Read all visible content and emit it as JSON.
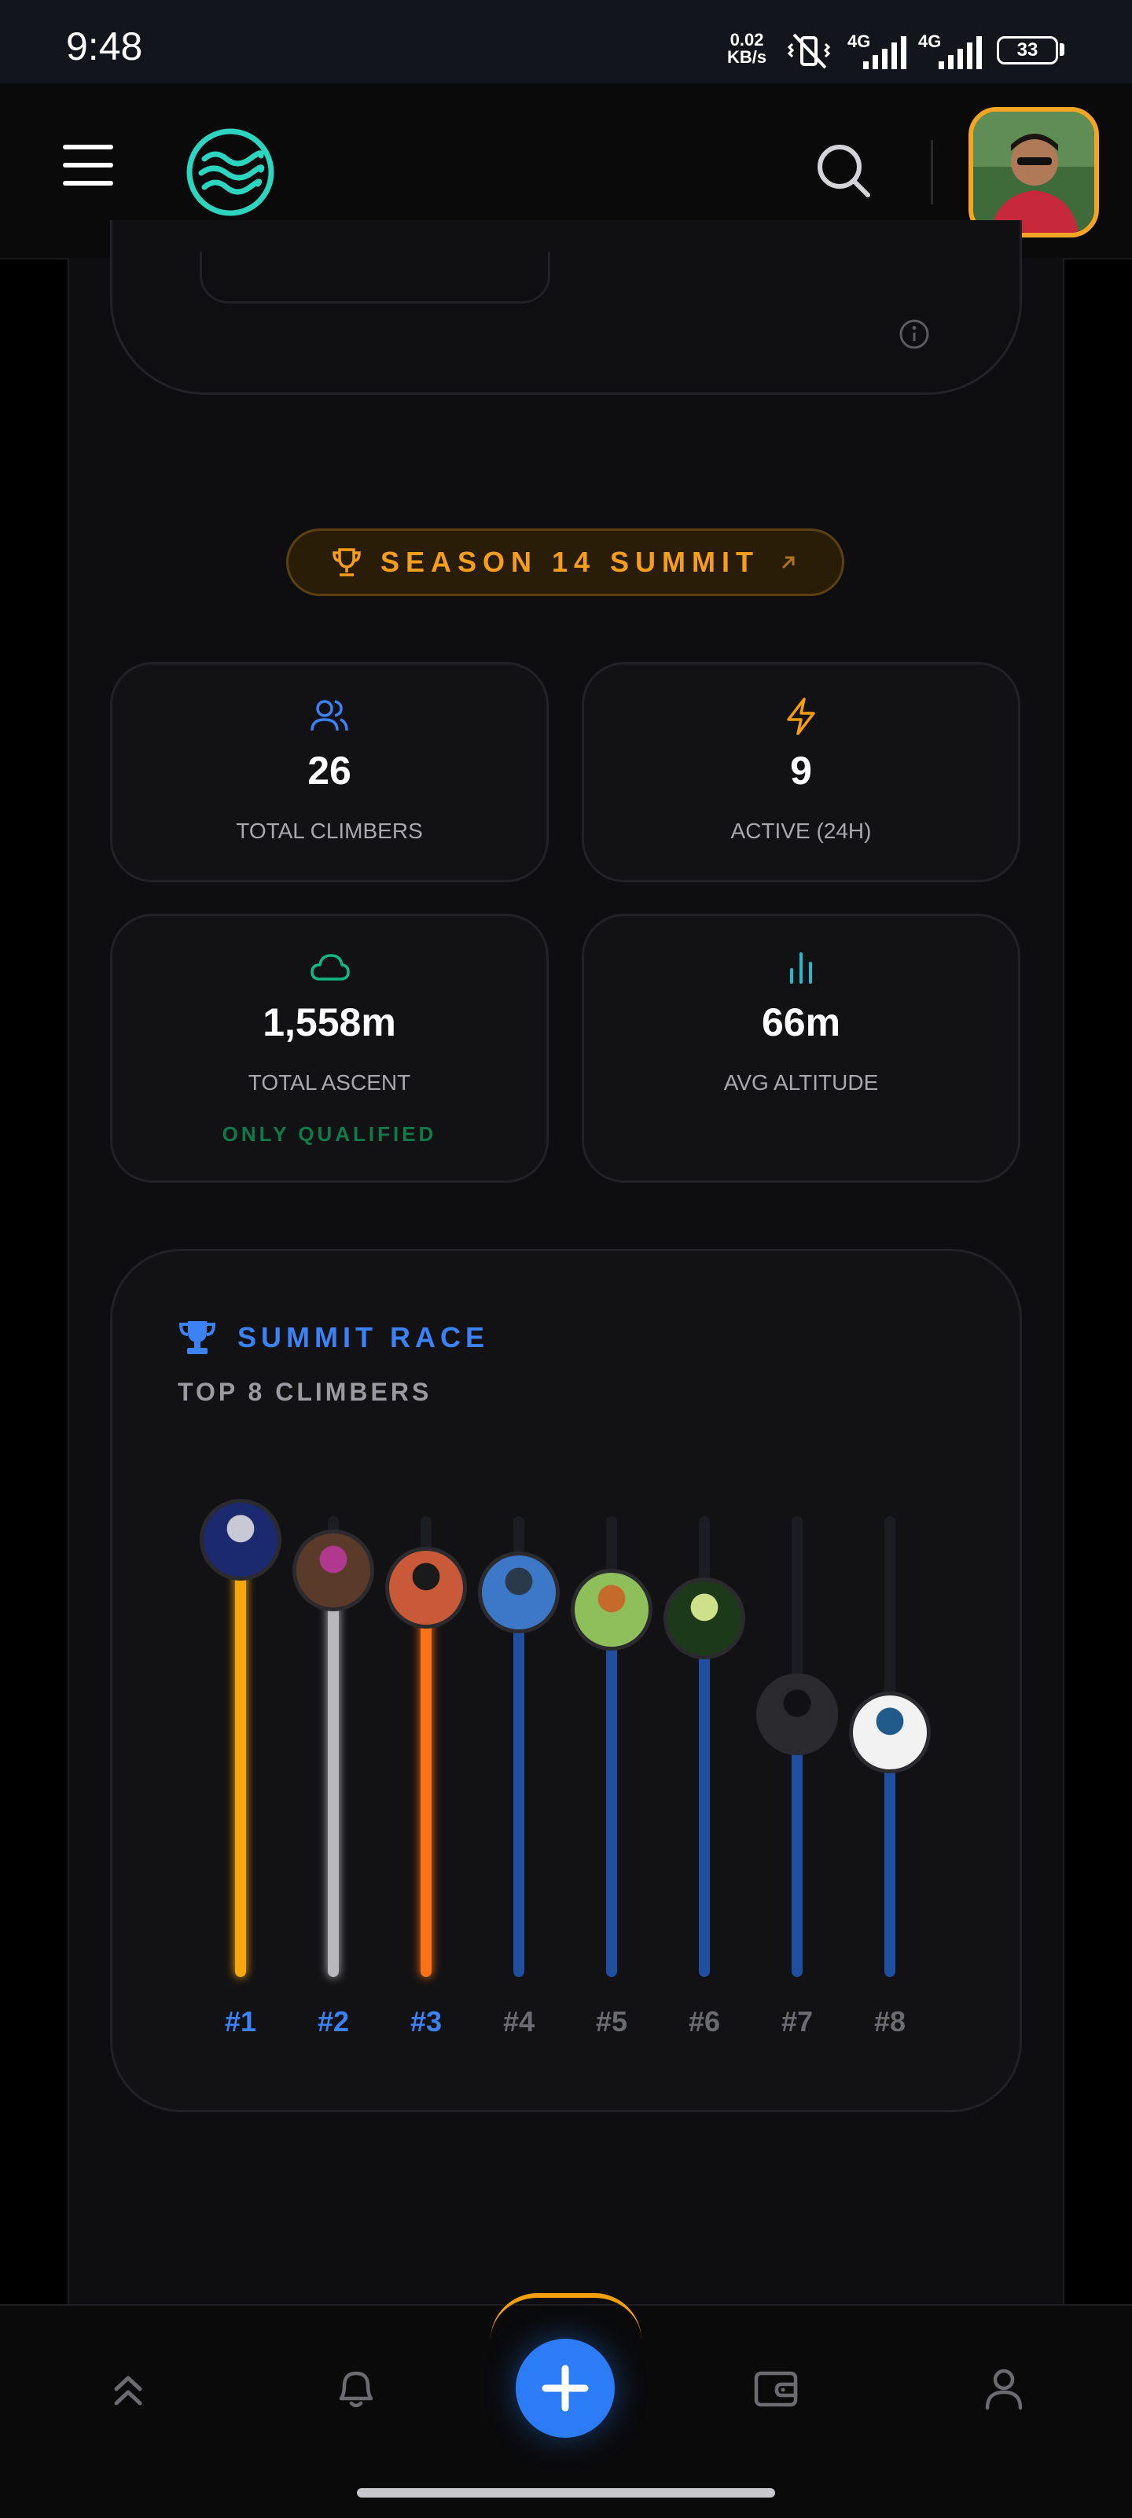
{
  "status_bar": {
    "time": "9:48",
    "net_speed_value": "0.02",
    "net_speed_unit": "KB/s",
    "network_1": "4G",
    "network_2": "4G",
    "battery": "33"
  },
  "header": {
    "menu_icon": "hamburger-menu-icon",
    "logo_icon": "waves-logo-icon",
    "search_icon": "search-icon",
    "avatar_icon": "user-avatar"
  },
  "season": {
    "label": "SEASON 14 SUMMIT"
  },
  "stats": [
    {
      "icon": "users-icon",
      "color": "#3b82f6",
      "value": "26",
      "label": "TOTAL CLIMBERS"
    },
    {
      "icon": "lightning-icon",
      "color": "#f59e0b",
      "value": "9",
      "label": "ACTIVE (24H)"
    },
    {
      "icon": "cloud-icon",
      "color": "#10b981",
      "value": "1,558m",
      "label": "TOTAL ASCENT",
      "note": "ONLY QUALIFIED"
    },
    {
      "icon": "bar-chart-icon",
      "color": "#22b8cf",
      "value": "66m",
      "label": "AVG ALTITUDE"
    }
  ],
  "race": {
    "title": "SUMMIT RACE",
    "subtitle": "TOP 8 CLIMBERS",
    "progress_fractions": [
      1.0,
      0.93,
      0.89,
      0.88,
      0.84,
      0.82,
      0.6,
      0.56
    ],
    "ranks": [
      "#1",
      "#2",
      "#3",
      "#4",
      "#5",
      "#6",
      "#7",
      "#8"
    ],
    "fill_colors": [
      "#f5a70d",
      "#b8b8bc",
      "#f97316",
      "#1e4fa0",
      "#1e4fa0",
      "#1e4fa0",
      "#1e4fa0",
      "#1e4fa0"
    ],
    "rank_colors": [
      "#3b82f6",
      "#3b82f6",
      "#3b82f6",
      "#6b6b72",
      "#6b6b72",
      "#6b6b72",
      "#6b6b72",
      "#6b6b72"
    ]
  },
  "bottom_nav": {
    "items": [
      "chevrons-up-icon",
      "bell-icon",
      "plus-icon",
      "wallet-icon",
      "user-icon"
    ]
  }
}
